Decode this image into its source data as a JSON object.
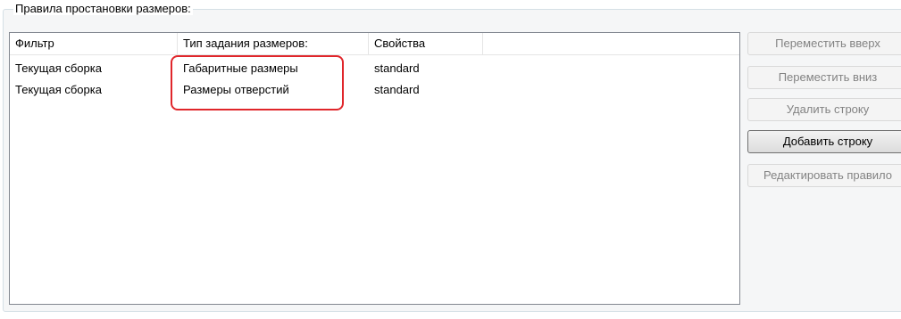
{
  "group": {
    "title": "Правила простановки размеров:"
  },
  "table": {
    "columns": [
      "Фильтр",
      "Тип задания размеров:",
      "Свойства"
    ],
    "rows": [
      [
        "Текущая сборка",
        "Габаритные размеры",
        "standard"
      ],
      [
        "Текущая сборка",
        "Размеры отверстий",
        "standard"
      ]
    ]
  },
  "buttons": {
    "move_up": "Переместить вверх",
    "move_down": "Переместить вниз",
    "delete_row": "Удалить строку",
    "add_row": "Добавить строку",
    "edit_rule": "Редактировать правило"
  },
  "colors": {
    "highlight": "#e0262b"
  }
}
